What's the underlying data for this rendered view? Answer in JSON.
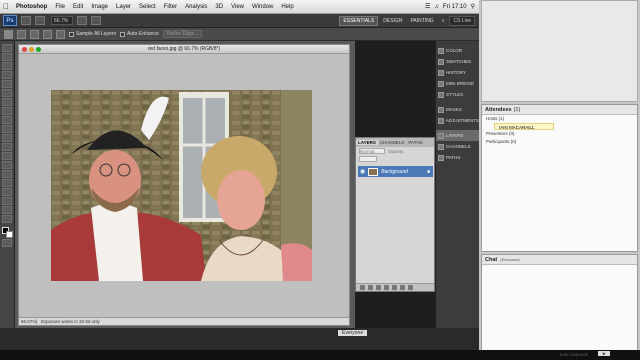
{
  "menubar": {
    "app": "Photoshop",
    "items": [
      "File",
      "Edit",
      "Image",
      "Layer",
      "Select",
      "Filter",
      "Analysis",
      "3D",
      "View",
      "Window",
      "Help"
    ],
    "clock": "Fri 17:10"
  },
  "appbar": {
    "logo": "Ps",
    "zoom": "66.7%",
    "workspaces": [
      "ESSENTIALS",
      "DESIGN",
      "PAINTING"
    ],
    "more": "»",
    "cs_live": "CS Live"
  },
  "options": {
    "sample_all_layers": "Sample All Layers",
    "auto_enhance": "Auto-Enhance",
    "refine_edge": "Refine Edge..."
  },
  "document": {
    "title": "red faces.jpg @ 66.7% (RGB/8*)",
    "zoom": "66.67%",
    "status": "Exposure works in 32-bit only"
  },
  "layers_panel": {
    "tabs": [
      "LAYERS",
      "CHANNELS",
      "PATHS"
    ],
    "blend_mode": "Normal",
    "opacity_label": "Opacity:",
    "layer_name": "Background"
  },
  "dock": {
    "group1": [
      "COLOR",
      "SWATCHES",
      "HISTORY",
      "MINI BRIDGE",
      "STYLES"
    ],
    "group2": [
      "MASKS",
      "ADJUSTMENTS"
    ],
    "group3": [
      "LAYERS",
      "CHANNELS",
      "PATHS"
    ]
  },
  "attendees": {
    "title": "Attendees",
    "count": "(1)",
    "hosts": "Hosts (1)",
    "host_name": "IAIN MACARAILL",
    "presenters": "Presenters (0)",
    "participants": "Participants (0)"
  },
  "chat": {
    "title": "Chat",
    "audience": "(Everyone)"
  },
  "bottom": {
    "everyone": "Everyone",
    "tray_time": "0:00 / 0:00 0:00"
  },
  "colors": {
    "layer_highlight": "#4b78b7",
    "host_highlight": "#fff6c9"
  }
}
